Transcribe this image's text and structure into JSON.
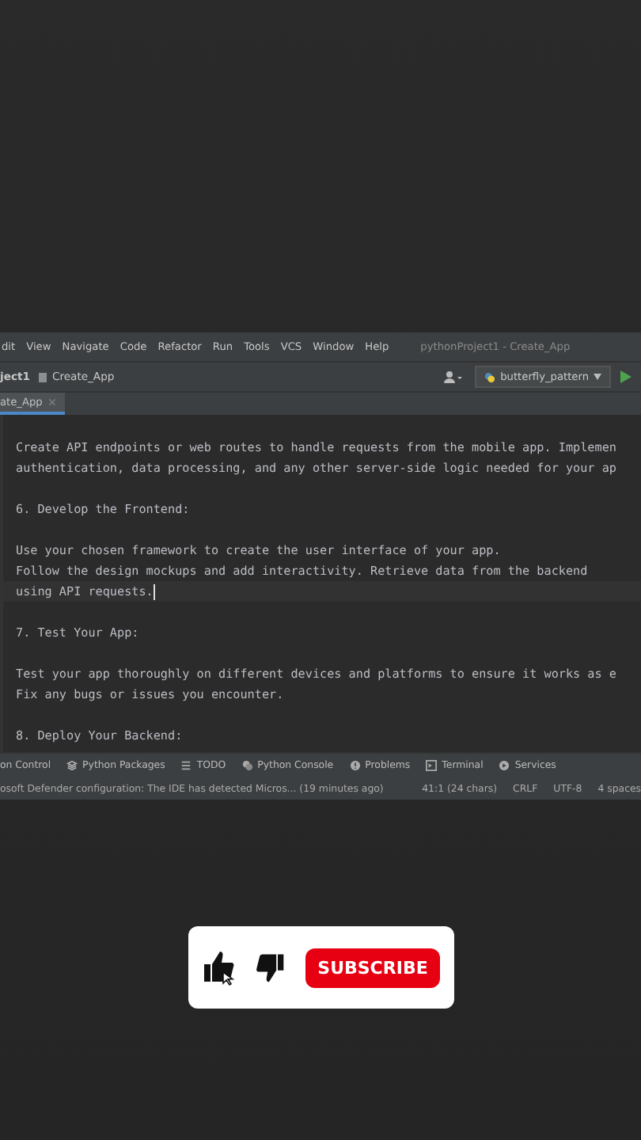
{
  "menu_bar": {
    "items": [
      "dit",
      "View",
      "Navigate",
      "Code",
      "Refactor",
      "Run",
      "Tools",
      "VCS",
      "Window",
      "Help"
    ],
    "title": "pythonProject1 - Create_App"
  },
  "nav_bar": {
    "project": "ject1",
    "breadcrumb": "Create_App",
    "run_config": "butterfly_pattern"
  },
  "editor_tabs": [
    {
      "label": "ate_App",
      "selected": true
    }
  ],
  "editor": {
    "paragraphs": [
      {
        "lines": [
          {
            "text": "Create API endpoints or web routes to handle requests from the mobile app. Implemen",
            "current": false
          },
          {
            "text": "authentication, data processing, and any other server-side logic needed for your ap",
            "current": false
          }
        ]
      },
      {
        "lines": [
          {
            "text": "6. Develop the Frontend:",
            "current": false
          }
        ]
      },
      {
        "lines": [
          {
            "text": "Use your chosen framework to create the user interface of your app.",
            "current": false
          },
          {
            "text": "Follow the design mockups and add interactivity. Retrieve data from the backend",
            "current": false
          },
          {
            "text": "using API requests.",
            "current": true
          }
        ]
      },
      {
        "lines": [
          {
            "text": "7. Test Your App:",
            "current": false
          }
        ]
      },
      {
        "lines": [
          {
            "text": "Test your app thoroughly on different devices and platforms to ensure it works as e",
            "current": false
          },
          {
            "text": "Fix any bugs or issues you encounter.",
            "current": false
          }
        ]
      },
      {
        "lines": [
          {
            "text": "8. Deploy Your Backend:",
            "current": false
          }
        ]
      }
    ]
  },
  "tool_windows": [
    {
      "kind": "vcs",
      "label": "on Control"
    },
    {
      "kind": "packages",
      "label": "Python Packages"
    },
    {
      "kind": "todo",
      "label": "TODO"
    },
    {
      "kind": "console",
      "label": "Python Console"
    },
    {
      "kind": "problems",
      "label": "Problems"
    },
    {
      "kind": "terminal",
      "label": "Terminal"
    },
    {
      "kind": "services",
      "label": "Services"
    }
  ],
  "status_bar": {
    "message": "osoft Defender configuration: The IDE has detected Micros... (19 minutes ago)",
    "position": "41:1 (24 chars)",
    "line_separator": "CRLF",
    "encoding": "UTF-8",
    "indent": "4 spaces"
  },
  "subscribe_card": {
    "button": "SUBSCRIBE"
  }
}
